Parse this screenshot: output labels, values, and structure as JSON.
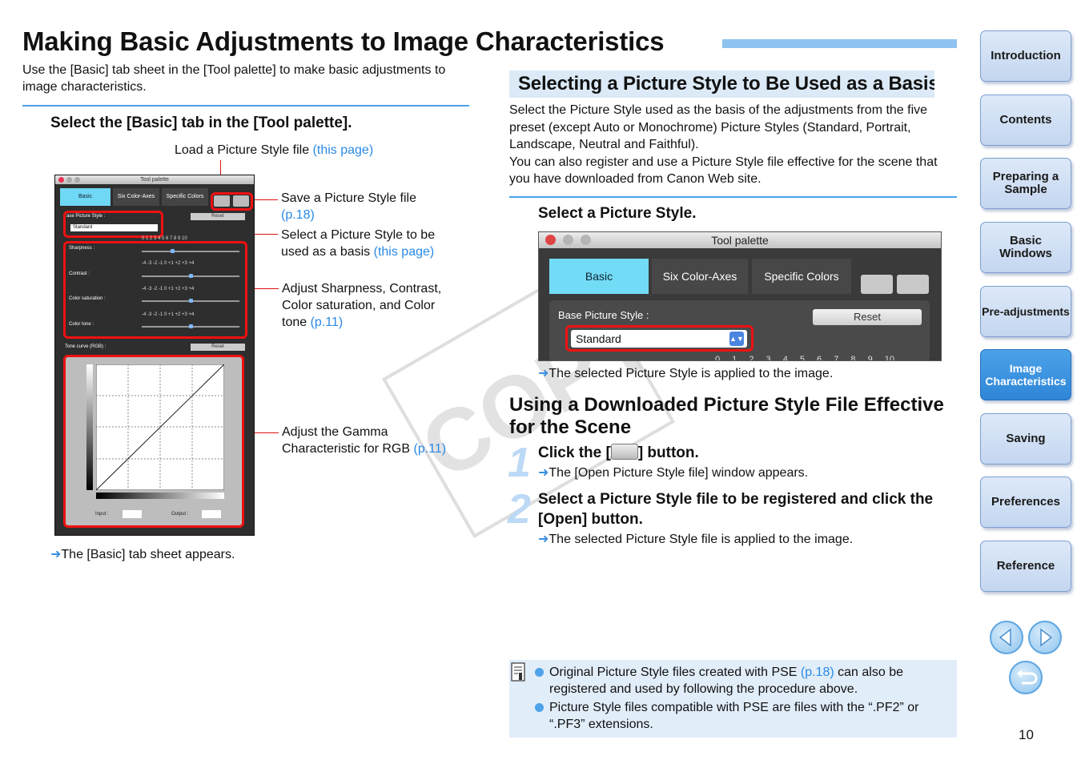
{
  "title": "Making Basic Adjustments to Image Characteristics",
  "intro": "Use the [Basic] tab sheet in the [Tool palette] to make basic adjustments to image characteristics.",
  "left": {
    "step": "Select the [Basic] tab in the [Tool palette].",
    "callouts": {
      "load": {
        "text": "Load a Picture Style file ",
        "link": "(this page)"
      },
      "save": {
        "text": "Save a Picture Style file",
        "link": "(p.18)"
      },
      "select_line1": "Select a Picture Style to be",
      "select_line2": "used as a basis ",
      "select_link": "(this page)",
      "adjust_line1": "Adjust Sharpness, Contrast,",
      "adjust_line2": "Color saturation, and Color",
      "adjust_line3": "tone ",
      "adjust_link": "(p.11)",
      "gamma_line1": "Adjust the Gamma",
      "gamma_line2": "Characteristic for RGB ",
      "gamma_link": "(p.11)"
    },
    "palette": {
      "title": "Tool palette",
      "tabs": [
        "Basic",
        "Six Color-Axes",
        "Specific Colors"
      ],
      "base_label": "ase Picture Style :",
      "reset": "Reset",
      "standard": "Standard",
      "sharpness": "Sharpness :",
      "contrast": "Contrast :",
      "color_saturation": "Color saturation :",
      "color_tone": "Color tone :",
      "tone_curve": "Tone curve (RGB) :",
      "input": "Input :",
      "output": "Output :",
      "scale_top": "0 1 2 3 4 5 6 7 8 9 10",
      "scale_pm": "-4 -3 -2 -1 0 +1 +2 +3 +4"
    },
    "result": "The [Basic] tab sheet appears."
  },
  "right": {
    "section_heading": "Selecting a Picture Style to Be Used as a Basis",
    "section_body_1": "Select the Picture Style used as the basis of the adjustments from the five preset (except Auto or Monochrome) Picture Styles (Standard, Portrait, Landscape, Neutral and Faithful).",
    "section_body_2": "You can also register and use a Picture Style file effective for the scene that you have downloaded from Canon Web site.",
    "step": "Select a Picture Style.",
    "shot": {
      "title": "Tool palette",
      "tabs": [
        "Basic",
        "Six Color-Axes",
        "Specific Colors"
      ],
      "base_label": "Base Picture Style :",
      "reset": "Reset",
      "standard": "Standard",
      "scale": "0 1 2 3 4 5 6 7 8 9 10"
    },
    "step_result": "The selected Picture Style is applied to the image.",
    "sub_heading": "Using a Downloaded Picture Style File Effective for the Scene",
    "steps": [
      {
        "num": "1",
        "title_before": "Click the [",
        "title_after": "] button.",
        "result": "The [Open Picture Style file] window appears."
      },
      {
        "num": "2",
        "title": "Select a Picture Style file to be registered and click the [Open] button.",
        "result": "The selected Picture Style file is applied to the image."
      }
    ],
    "notes": [
      {
        "text_before": "Original Picture Style files created with PSE ",
        "link": "(p.18)",
        "text_after": " can also be registered and used by following the procedure above."
      },
      {
        "text": "Picture Style files compatible with PSE are files with the “.PF2” or “.PF3” extensions."
      }
    ]
  },
  "watermark": "COPY",
  "nav": {
    "items": [
      "Introduction",
      "Contents",
      "Preparing a Sample",
      "Basic Windows",
      "Pre-adjustments",
      "Image Characteristics",
      "Saving",
      "Preferences",
      "Reference"
    ],
    "active": "Image Characteristics"
  },
  "page_number": "10",
  "colors": {
    "accent": "#4aa2e8",
    "highlight_red": "#e11111",
    "active_nav": "#2f86d8"
  }
}
